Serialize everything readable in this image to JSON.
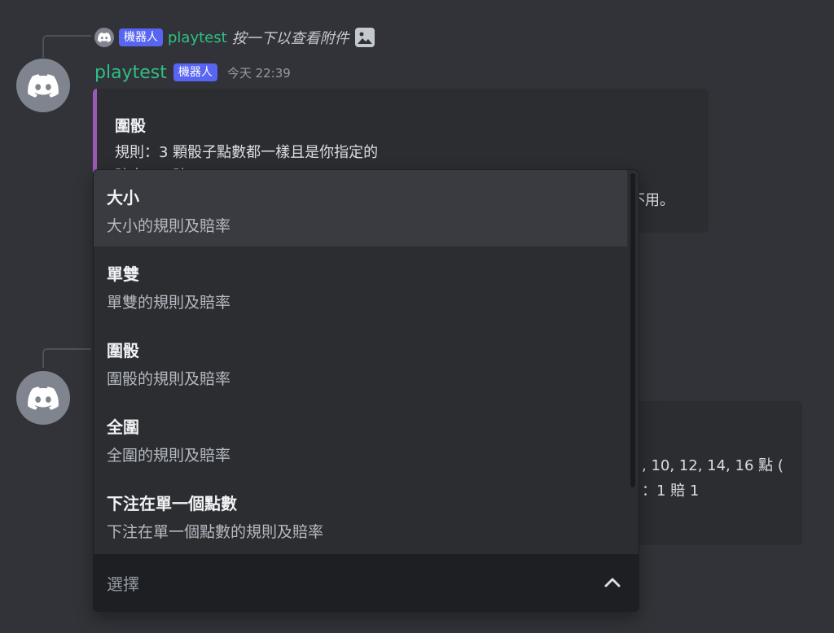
{
  "reply": {
    "bot_tag": "機器人",
    "username": "playtest",
    "text": "按一下以查看附件"
  },
  "message": {
    "username": "playtest",
    "bot_tag": "機器人",
    "timestamp": "今天 22:39"
  },
  "embed1": {
    "title": "圍骰",
    "rule": "規則：3 顆骰子點數都一樣且是你指定的",
    "odds_partial": "賠率：1 賠 180",
    "trailing": "不用。"
  },
  "embed2": {
    "line1": ", 10, 12, 14, 16 點 (",
    "line2": "：1 賠 1"
  },
  "dropdown": {
    "options": [
      {
        "label": "大小",
        "description": "大小的規則及賠率"
      },
      {
        "label": "單雙",
        "description": "單雙的規則及賠率"
      },
      {
        "label": "圍骰",
        "description": "圍骰的規則及賠率"
      },
      {
        "label": "全圍",
        "description": "全圍的規則及賠率"
      },
      {
        "label": "下注在單一個點數",
        "description": "下注在單一個點數的規則及賠率"
      }
    ],
    "placeholder": "選擇"
  },
  "colors": {
    "background": "#313338",
    "accent": "#5865f2",
    "username": "#2fbf85",
    "embed_bar": "#9b59b6"
  }
}
